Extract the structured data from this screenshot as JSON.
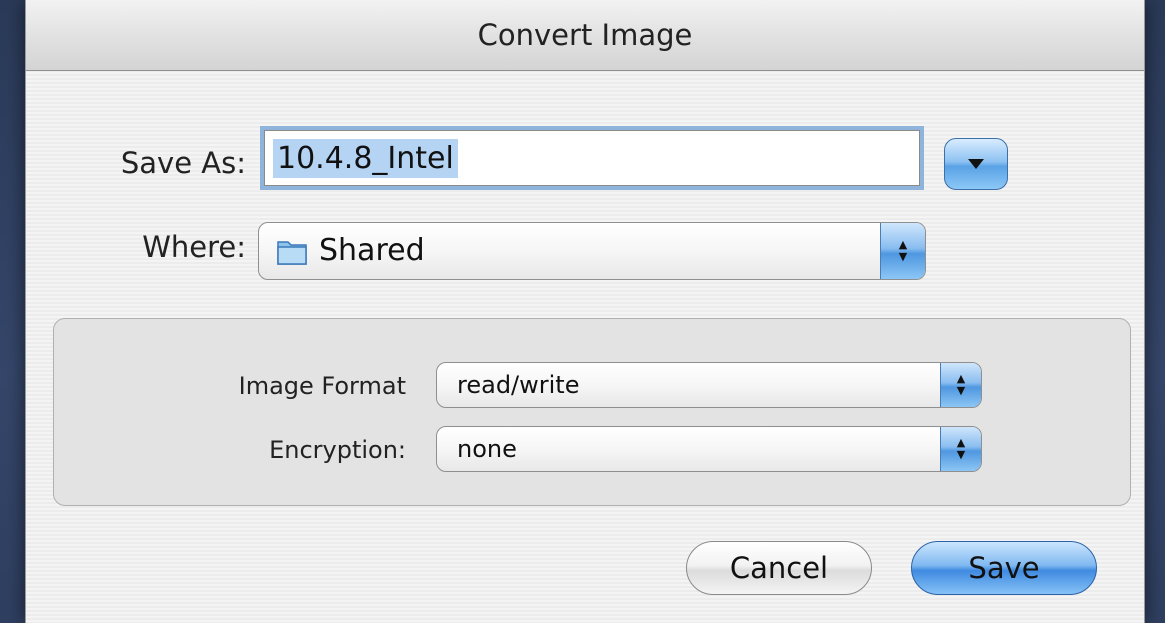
{
  "dialog": {
    "title": "Convert Image",
    "save_as_label": "Save As:",
    "save_as_value": "10.4.8_Intel",
    "where_label": "Where:",
    "where_value": "Shared",
    "where_icon": "folder-icon",
    "options": {
      "image_format_label": "Image Format",
      "image_format_value": "read/write",
      "encryption_label": "Encryption:",
      "encryption_value": "none"
    },
    "buttons": {
      "cancel": "Cancel",
      "save": "Save"
    }
  },
  "colors": {
    "accent_blue": "#5aa2e6",
    "selection": "#b5d3f3"
  }
}
